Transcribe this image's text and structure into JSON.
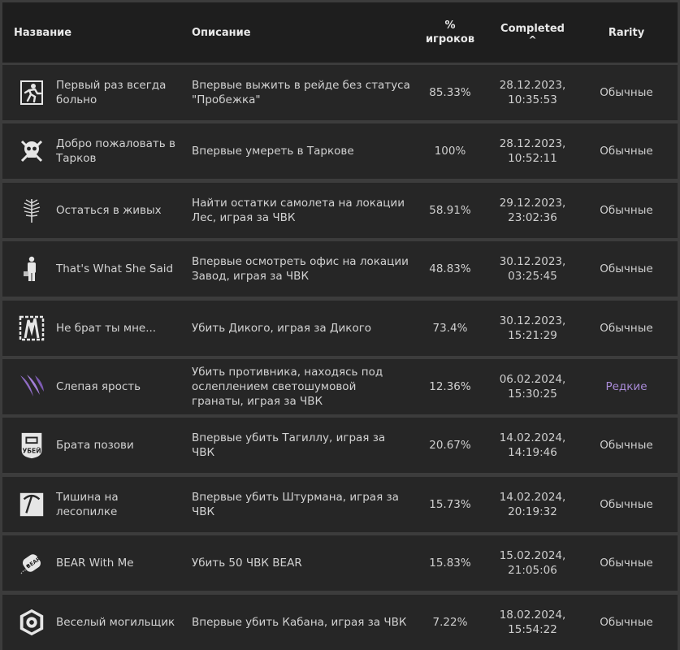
{
  "header": {
    "name": "Название",
    "description": "Описание",
    "percent_line1": "%",
    "percent_line2": "игроков",
    "completed": "Completed",
    "sort_indicator": "^",
    "rarity": "Rarity"
  },
  "rows": [
    {
      "icon": "running-man-exit-icon",
      "name": "Первый раз всегда больно",
      "description": "Впервые выжить в рейде без статуса \"Пробежка\"",
      "percent": "85.33%",
      "date": "28.12.2023,",
      "time": "10:35:53",
      "rarity": "Обычные"
    },
    {
      "icon": "skull-crossbones-icon",
      "name": "Добро пожаловать в Тарков",
      "description": "Впервые умереть в Таркове",
      "percent": "100%",
      "date": "28.12.2023,",
      "time": "10:52:11",
      "rarity": "Обычные"
    },
    {
      "icon": "fern-leaf-icon",
      "name": "Остаться в живых",
      "description": "Найти остатки самолета на локации Лес, играя за ЧВК",
      "percent": "58.91%",
      "date": "29.12.2023,",
      "time": "23:02:36",
      "rarity": "Обычные"
    },
    {
      "icon": "office-man-briefcase-icon",
      "name": "That's What She Said",
      "description": "Впервые осмотреть офис на локации Завод, играя за ЧВК",
      "percent": "48.83%",
      "date": "30.12.2023,",
      "time": "03:25:45",
      "rarity": "Обычные"
    },
    {
      "icon": "scav-crest-icon",
      "name": "Не брат ты мне...",
      "description": "Убить Дикого, играя за Дикого",
      "percent": "73.4%",
      "date": "30.12.2023,",
      "time": "15:21:29",
      "rarity": "Обычные"
    },
    {
      "icon": "purple-claw-icon",
      "name": "Слепая ярость",
      "description": "Убить противника, находясь под ослеплением светошумовой гранаты, играя за ЧВК",
      "percent": "12.36%",
      "date": "06.02.2024,",
      "time": "15:30:25",
      "rarity": "Редкие",
      "rare": true
    },
    {
      "icon": "ubei-shield-icon",
      "name": "Брата позови",
      "description": "Впервые убить Тагиллу, играя за ЧВК",
      "percent": "20.67%",
      "date": "14.02.2024,",
      "time": "14:19:46",
      "rarity": "Обычные"
    },
    {
      "icon": "pickaxe-badge-icon",
      "name": "Тишина на лесопилке",
      "description": "Впервые убить Штурмана, играя за ЧВК",
      "percent": "15.73%",
      "date": "14.02.2024,",
      "time": "20:19:32",
      "rarity": "Обычные"
    },
    {
      "icon": "bear-dogtag-icon",
      "name": "BEAR With Me",
      "description": "Убить 50 ЧВК BEAR",
      "percent": "15.83%",
      "date": "15.02.2024,",
      "time": "21:05:06",
      "rarity": "Обычные"
    },
    {
      "icon": "boar-badge-icon",
      "name": "Веселый могильщик",
      "description": "Впервые убить Кабана, играя за ЧВК",
      "percent": "7.22%",
      "date": "18.02.2024,",
      "time": "15:54:22",
      "rarity": "Обычные"
    }
  ],
  "colors": {
    "header_bg": "#1e1e1e",
    "row_bg": "#262626",
    "separator": "#3c3c3c",
    "rare": "#a98bd8"
  }
}
